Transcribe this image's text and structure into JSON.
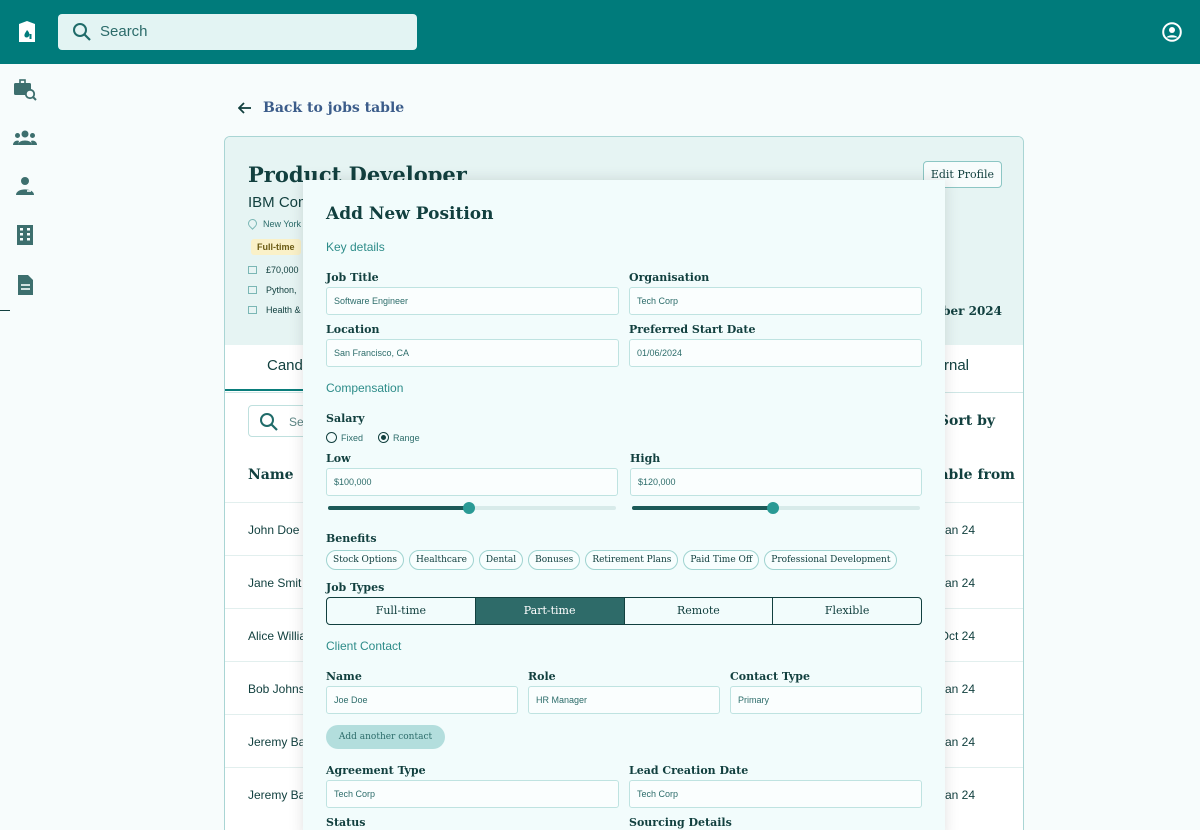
{
  "topbar": {
    "search_placeholder": "Search"
  },
  "back_link": "Back to jobs table",
  "job_card": {
    "title": "Product Developer",
    "company": "IBM Com",
    "location": "New York",
    "badge": "Full-time",
    "salary": "£70,000",
    "skills": "Python,",
    "benefits": "Health &",
    "edit_label": "Edit Profile",
    "date_fragment": "mber 2024",
    "tab_left": "Cand",
    "tab_right": "rnal",
    "search_fragment": "Se",
    "sort_label": "Sort by",
    "col_name": "Name",
    "col_available": "ilable from",
    "rows": [
      {
        "name": "John Doe",
        "date": "an 24"
      },
      {
        "name": "Jane Smit",
        "date": "an 24"
      },
      {
        "name": "Alice Willia",
        "date": "Oct 24"
      },
      {
        "name": "Bob Johns",
        "date": "an 24"
      },
      {
        "name": "Jeremy Ba",
        "date": "an 24"
      },
      {
        "name": "Jeremy Ba",
        "date": "an 24"
      }
    ]
  },
  "modal": {
    "title": "Add New Position",
    "sections": {
      "key": "Key details",
      "comp": "Compensation",
      "contact": "Client Contact"
    },
    "labels": {
      "job_title": "Job Title",
      "organisation": "Organisation",
      "location": "Location",
      "start_date": "Preferred Start Date",
      "salary": "Salary",
      "low": "Low",
      "high": "High",
      "benefits": "Benefits",
      "job_types": "Job Types",
      "name": "Name",
      "role": "Role",
      "contact_type": "Contact Type",
      "agreement_type": "Agreement Type",
      "lead_date": "Lead Creation Date",
      "status": "Status",
      "sourcing": "Sourcing Details"
    },
    "values": {
      "job_title": "Software Engineer",
      "organisation": "Tech Corp",
      "location": "San Francisco, CA",
      "start_date": "01/06/2024",
      "low": "$100,000",
      "high": "$120,000",
      "name": "Joe Doe",
      "role": "HR Manager",
      "contact_type": "Primary",
      "agreement_type": "Tech Corp",
      "lead_date": "Tech Corp"
    },
    "salary_mode": {
      "fixed": "Fixed",
      "range": "Range",
      "selected": "Range"
    },
    "sliders": {
      "low_fraction": 0.49,
      "high_fraction": 0.49
    },
    "benefit_chips": [
      "Stock Options",
      "Healthcare",
      "Dental",
      "Bonuses",
      "Retirement Plans",
      "Paid Time Off",
      "Professional Development"
    ],
    "job_type_options": [
      "Full-time",
      "Part-time",
      "Remote",
      "Flexible"
    ],
    "job_type_selected": "Part-time",
    "add_contact_label": "Add another contact"
  }
}
